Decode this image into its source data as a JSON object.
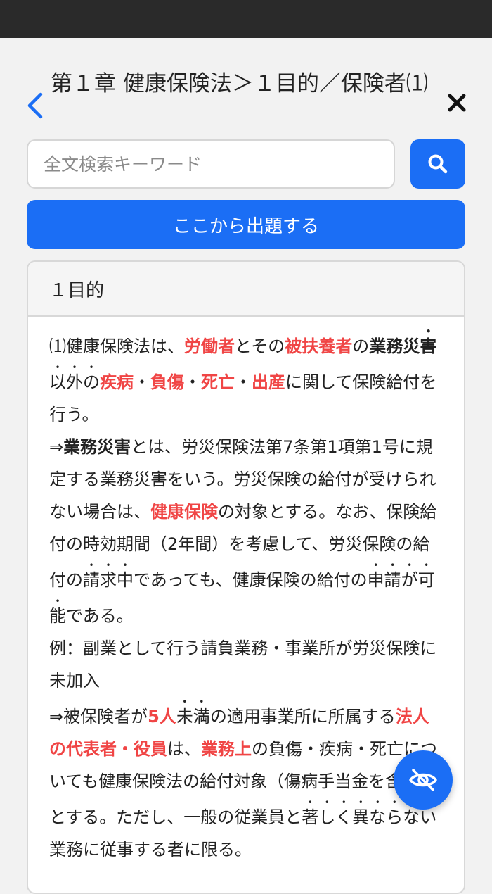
{
  "header": {
    "title": "第１章 健康保険法＞１目的／保険者⑴"
  },
  "search": {
    "placeholder": "全文検索キーワード",
    "value": ""
  },
  "actions": {
    "start_label": "ここから出題する"
  },
  "section": {
    "heading": "１目的",
    "p1": [
      "⑴健康保険法は、",
      "労働者",
      "とその",
      "被扶養者",
      "の",
      "業務災",
      "害",
      "以外の",
      "疾病",
      "・",
      "負傷",
      "・",
      "死亡",
      "・",
      "出産",
      "に関して保険給付を行う。"
    ],
    "p2": [
      "⇒",
      "業務災害",
      "とは、労災保険法第7条第1項第1号に規定する業務災害をいう。労災保険の給付が受けられない場合は、",
      "健康保険",
      "の対象とする。なお、保険給付の時効期間（2年間）を考慮して、労災保険の給付の",
      "請求中",
      "であっても、健康保険の給付の",
      "申請が可能",
      "である。"
    ],
    "p3": "例：副業として行う請負業務・事業所が労災保険に未加入",
    "p4": [
      "⇒被保険者が",
      "5人",
      "未満",
      "の適用事業所に所属する",
      "法人の代表者・役員",
      "は、",
      "業務上",
      "の負傷・疾病・死亡についても健康保険法の給付対象（傷病手当金を含む）とする。ただし、一般の従業員と",
      "著しく異",
      "なら",
      "ない業務に従事する者に限る。"
    ]
  },
  "icons": {
    "back": "chevron-left-icon",
    "close": "close-icon",
    "search": "search-icon",
    "fab": "eye-off-icon"
  },
  "colors": {
    "accent": "#1b6ef5",
    "highlight": "#f04545"
  }
}
